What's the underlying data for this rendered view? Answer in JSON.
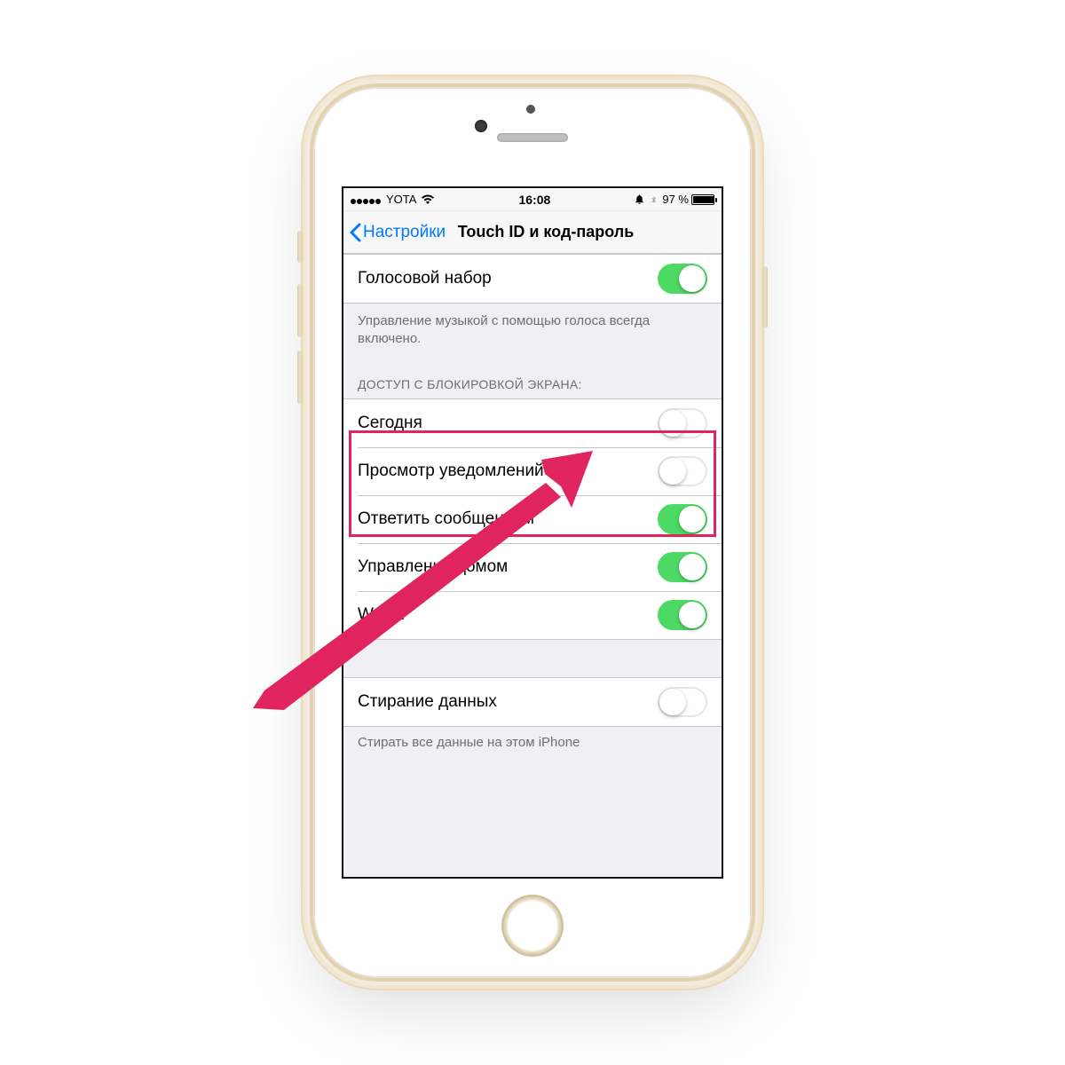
{
  "status": {
    "carrier": "YOTA",
    "time": "16:08",
    "battery_pct": "97 %"
  },
  "nav": {
    "back_label": "Настройки",
    "title": "Touch ID и код-пароль"
  },
  "rows": {
    "voice_dial": {
      "label": "Голосовой набор",
      "on": true
    },
    "voice_footer": "Управление музыкой с помощью голоса всегда включено.",
    "lock_header": "ДОСТУП С БЛОКИРОВКОЙ ЭКРАНА:",
    "today": {
      "label": "Сегодня",
      "on": false
    },
    "notif": {
      "label": "Просмотр уведомлений",
      "on": false
    },
    "reply": {
      "label": "Ответить сообщением",
      "on": true
    },
    "home": {
      "label": "Управление домом",
      "on": true
    },
    "wallet": {
      "label": "Wallet",
      "on": true
    },
    "erase": {
      "label": "Стирание данных",
      "on": false
    },
    "erase_footer": "Стирать все данные на этом iPhone"
  },
  "annotation": {
    "highlight_color": "#e0245e"
  }
}
